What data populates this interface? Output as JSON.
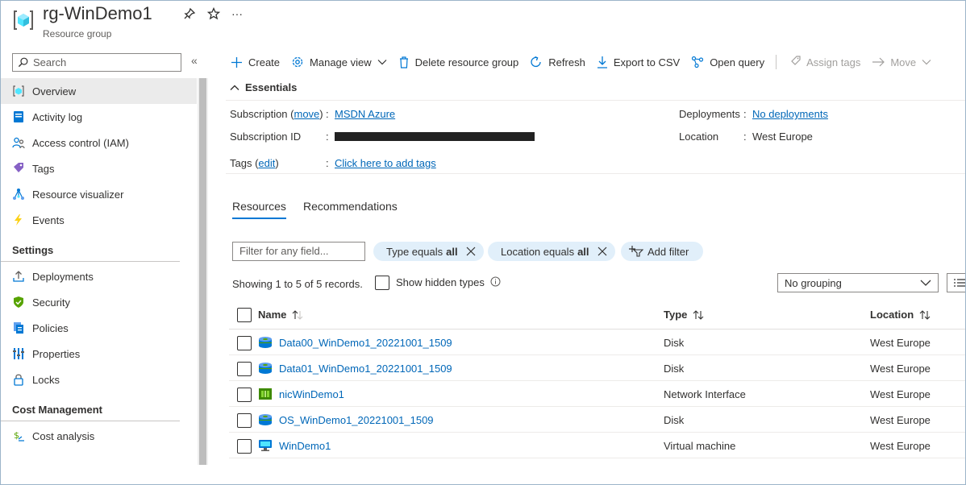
{
  "header": {
    "title": "rg-WinDemo1",
    "subtitle": "Resource group",
    "pin": "pin-icon",
    "star": "star-icon",
    "more": "···"
  },
  "sidebar": {
    "search_placeholder": "Search",
    "collapse": "«",
    "items": [
      {
        "label": "Overview",
        "icon": "resource-group-icon",
        "active": true
      },
      {
        "label": "Activity log",
        "icon": "activity-log-icon"
      },
      {
        "label": "Access control (IAM)",
        "icon": "iam-icon"
      },
      {
        "label": "Tags",
        "icon": "tag-icon"
      },
      {
        "label": "Resource visualizer",
        "icon": "visualizer-icon"
      },
      {
        "label": "Events",
        "icon": "lightning-icon"
      }
    ],
    "settings_heading": "Settings",
    "settings_items": [
      {
        "label": "Deployments",
        "icon": "upload-icon"
      },
      {
        "label": "Security",
        "icon": "shield-icon"
      },
      {
        "label": "Policies",
        "icon": "policy-icon"
      },
      {
        "label": "Properties",
        "icon": "properties-icon"
      },
      {
        "label": "Locks",
        "icon": "lock-icon"
      }
    ],
    "cost_heading": "Cost Management",
    "cost_items": [
      {
        "label": "Cost analysis",
        "icon": "cost-analysis-icon"
      }
    ]
  },
  "toolbar": {
    "create": "Create",
    "manage_view": "Manage view",
    "delete": "Delete resource group",
    "refresh": "Refresh",
    "export": "Export to CSV",
    "open_query": "Open query",
    "assign_tags": "Assign tags",
    "move": "Move"
  },
  "essentials": {
    "heading": "Essentials",
    "subscription_label": "Subscription (",
    "subscription_move": "move",
    "subscription_label_end": ")",
    "subscription_value": "MSDN Azure",
    "subscription_id_label": "Subscription ID",
    "tags_label": "Tags (",
    "tags_edit": "edit",
    "tags_label_end": ")",
    "tags_value": "Click here to add tags",
    "deployments_label": "Deployments",
    "deployments_value": "No deployments",
    "location_label": "Location",
    "location_value": "West Europe",
    "sep": ":"
  },
  "tabs": [
    "Resources",
    "Recommendations"
  ],
  "filters": {
    "placeholder": "Filter for any field...",
    "type_pill": "Type equals",
    "type_value": "all",
    "location_pill": "Location equals",
    "location_value": "all",
    "add_filter": "Add filter"
  },
  "records": "Showing 1 to 5 of 5 records.",
  "show_hidden": "Show hidden types",
  "grouping": "No grouping",
  "table": {
    "columns": [
      "Name",
      "Type",
      "Location"
    ],
    "rows": [
      {
        "name": "Data00_WinDemo1_20221001_1509",
        "type": "Disk",
        "location": "West Europe",
        "icon": "disk-icon"
      },
      {
        "name": "Data01_WinDemo1_20221001_1509",
        "type": "Disk",
        "location": "West Europe",
        "icon": "disk-icon"
      },
      {
        "name": "nicWinDemo1",
        "type": "Network Interface",
        "location": "West Europe",
        "icon": "network-interface-icon"
      },
      {
        "name": "OS_WinDemo1_20221001_1509",
        "type": "Disk",
        "location": "West Europe",
        "icon": "disk-icon"
      },
      {
        "name": "WinDemo1",
        "type": "Virtual machine",
        "location": "West Europe",
        "icon": "virtual-machine-icon"
      }
    ]
  },
  "colors": {
    "accent": "#0078d4",
    "link": "#0067b8",
    "pill": "#e1effa"
  }
}
